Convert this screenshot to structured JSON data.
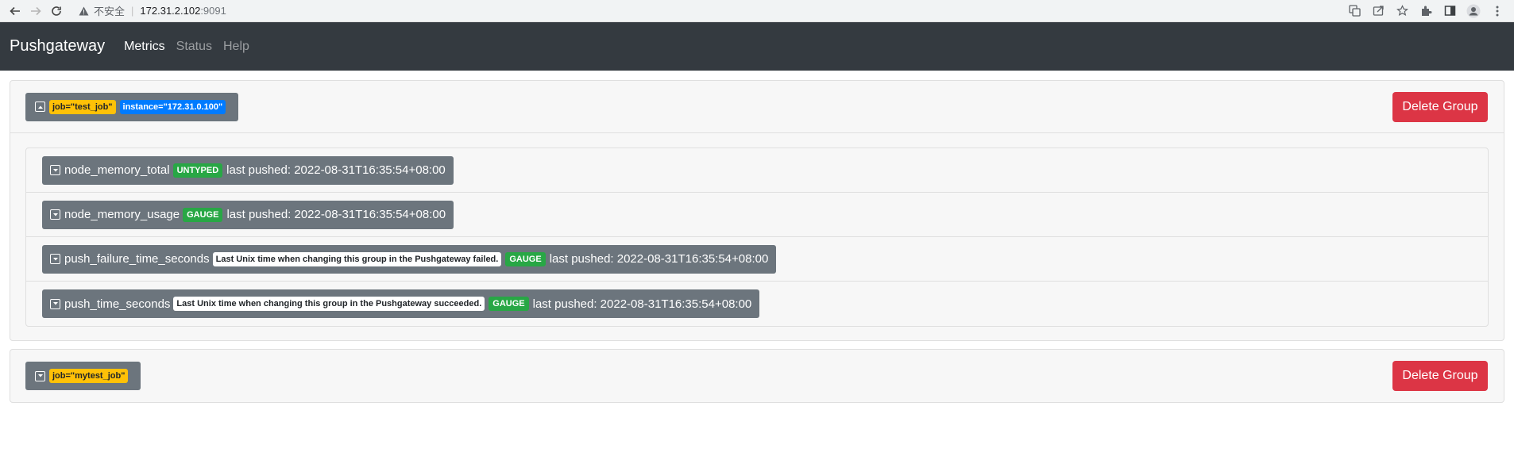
{
  "browser": {
    "insecure_label": "不安全",
    "url_host": "172.31.2.102",
    "url_port": ":9091"
  },
  "navbar": {
    "brand": "Pushgateway",
    "links": [
      {
        "label": "Metrics",
        "active": true
      },
      {
        "label": "Status",
        "active": false
      },
      {
        "label": "Help",
        "active": false
      }
    ]
  },
  "groups": [
    {
      "job_label": "job=\"test_job\"",
      "instance_label": "instance=\"172.31.0.100\"",
      "delete_label": "Delete Group",
      "expanded": true,
      "metrics": [
        {
          "name": "node_memory_total",
          "help": "",
          "type": "UNTYPED",
          "pushed": "last pushed: 2022-08-31T16:35:54+08:00"
        },
        {
          "name": "node_memory_usage",
          "help": "",
          "type": "GAUGE",
          "pushed": "last pushed: 2022-08-31T16:35:54+08:00"
        },
        {
          "name": "push_failure_time_seconds",
          "help": "Last Unix time when changing this group in the Pushgateway failed.",
          "type": "GAUGE",
          "pushed": "last pushed: 2022-08-31T16:35:54+08:00"
        },
        {
          "name": "push_time_seconds",
          "help": "Last Unix time when changing this group in the Pushgateway succeeded.",
          "type": "GAUGE",
          "pushed": "last pushed: 2022-08-31T16:35:54+08:00"
        }
      ]
    },
    {
      "job_label": "job=\"mytest_job\"",
      "delete_label": "Delete Group",
      "expanded": false
    }
  ],
  "colors": {
    "navbar_bg": "#343a40",
    "job_badge": "#ffc107",
    "instance_badge": "#007bff",
    "type_badge": "#28a745",
    "delete_button": "#dc3545",
    "pill": "#6c757d"
  }
}
